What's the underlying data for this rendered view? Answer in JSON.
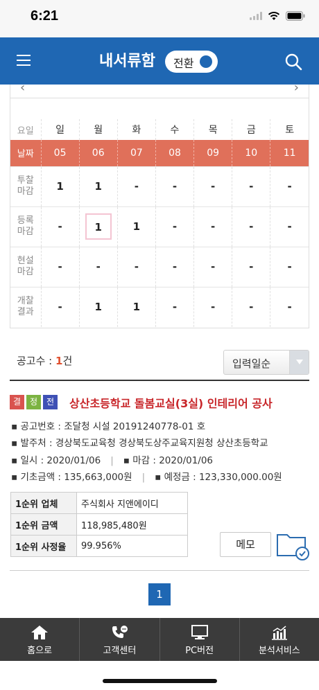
{
  "status_bar": {
    "time": "6:21"
  },
  "header": {
    "title": "내서류함",
    "toggle_label": "전환"
  },
  "calendar": {
    "day_header_label": "요일",
    "days": [
      "일",
      "월",
      "화",
      "수",
      "목",
      "금",
      "토"
    ],
    "date_header_label": "날짜",
    "dates": [
      "05",
      "06",
      "07",
      "08",
      "09",
      "10",
      "11"
    ],
    "rows": [
      {
        "label_line1": "투찰",
        "label_line2": "마감",
        "values": [
          "1",
          "1",
          "-",
          "-",
          "-",
          "-",
          "-"
        ]
      },
      {
        "label_line1": "등록",
        "label_line2": "마감",
        "values": [
          "-",
          "1",
          "1",
          "-",
          "-",
          "-",
          "-"
        ]
      },
      {
        "label_line1": "현설",
        "label_line2": "마감",
        "values": [
          "-",
          "-",
          "-",
          "-",
          "-",
          "-",
          "-"
        ]
      },
      {
        "label_line1": "개찰",
        "label_line2": "결과",
        "values": [
          "-",
          "1",
          "1",
          "-",
          "-",
          "-",
          "-"
        ]
      }
    ]
  },
  "list": {
    "count_label": "공고수 : ",
    "count_value": "1",
    "count_unit": "건",
    "sort_selected": "입력일순"
  },
  "notice": {
    "badges": [
      {
        "text": "결",
        "color": "#d9534f"
      },
      {
        "text": "정",
        "color": "#7cb342"
      },
      {
        "text": "전",
        "color": "#3f51b5"
      }
    ],
    "title": "상산초등학교 돌봄교실(3실) 인테리어 공사",
    "bid_no": "▪ 공고번호 : 조달청 시설 20191240778-01 호",
    "orderer": "▪ 발주처 : 경상북도교육청 경상북도상주교육지원청 상산초등학교",
    "date": "▪ 일시 : 2020/01/06",
    "deadline": "▪ 마감 : 2020/01/06",
    "base_amount": "▪ 기초금액 : 135,663,000원",
    "estimated_price": "▪ 예정금 : 123,330,000.00원",
    "result": {
      "company_label": "1순위 업체",
      "company_value": "주식회사 지앤에이디",
      "amount_label": "1순위 금액",
      "amount_value": "118,985,480원",
      "rate_label": "1순위 사정율",
      "rate_value": "99.956%"
    },
    "memo_label": "메모"
  },
  "pagination": {
    "current": "1"
  },
  "tabbar": {
    "home": "홈으로",
    "support": "고객센터",
    "pc": "PC버전",
    "analysis": "분석서비스"
  },
  "colors": {
    "primary": "#1f67b3",
    "date_row": "#e0705a",
    "title_red": "#c8262a",
    "tabbar": "#3b3b3b"
  }
}
